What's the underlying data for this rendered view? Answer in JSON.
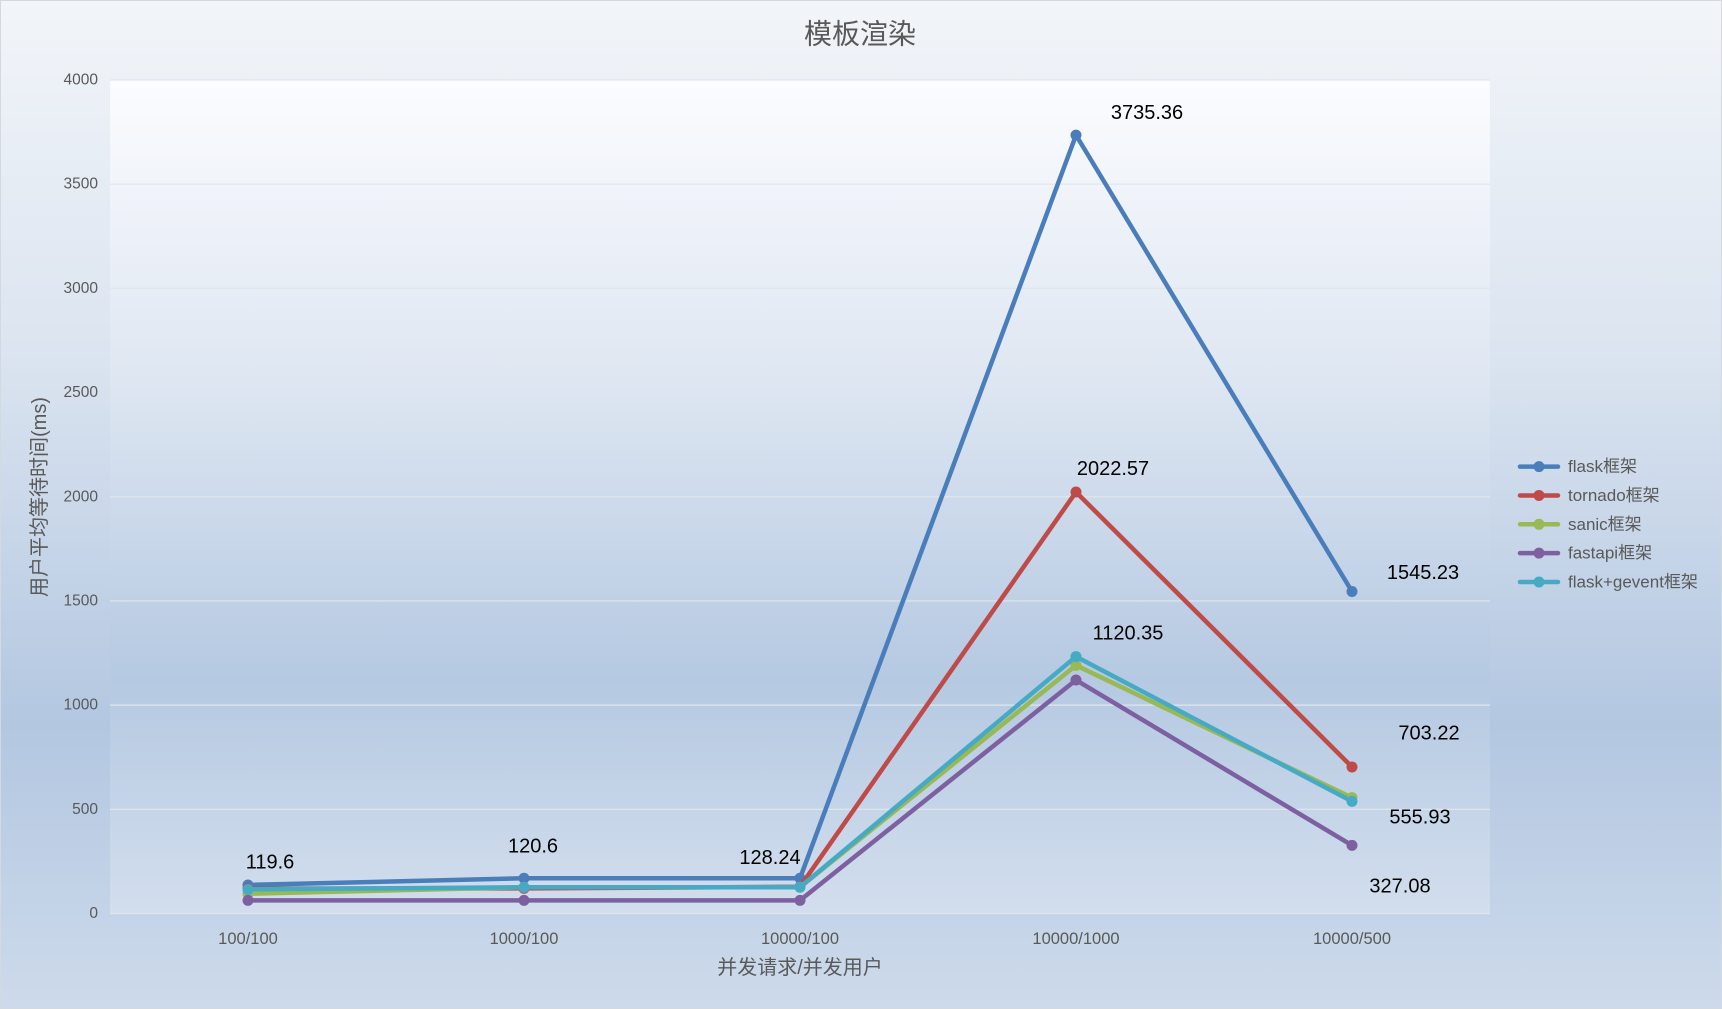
{
  "chart_data": {
    "type": "line",
    "title": "模板渲染",
    "xlabel": "并发请求/并发用户",
    "ylabel": "用户平均等待时间(ms)",
    "categories": [
      "100/100",
      "1000/100",
      "10000/100",
      "10000/1000",
      "10000/500"
    ],
    "ylim": [
      0,
      4000
    ],
    "yticks": [
      0,
      500,
      1000,
      1500,
      2000,
      2500,
      3000,
      3500,
      4000
    ],
    "grid": true,
    "markers": true,
    "legend_position": "right",
    "series": [
      {
        "name": "flask框架",
        "color": "#4A7EBB",
        "values": [
          137,
          169,
          169,
          3735.36,
          1545.23
        ],
        "labels": [
          null,
          null,
          null,
          "3735.36",
          "1545.23"
        ]
      },
      {
        "name": "tornado框架",
        "color": "#BE4B48",
        "values": [
          119.6,
          120.6,
          128.24,
          2022.57,
          703.22
        ],
        "labels": [
          "119.6",
          "120.6",
          "128.24",
          "2022.57",
          "703.22"
        ]
      },
      {
        "name": "sanic框架",
        "color": "#98B954",
        "values": [
          95,
          126,
          126,
          1191,
          555.93
        ],
        "labels": [
          null,
          null,
          null,
          null,
          "555.93"
        ]
      },
      {
        "name": "fastapi框架",
        "color": "#7D60A0",
        "values": [
          63,
          63,
          63,
          1120.35,
          327.08
        ],
        "labels": [
          null,
          null,
          null,
          "1120.35",
          "327.08"
        ]
      },
      {
        "name": "flask+gevent框架",
        "color": "#46AAC5",
        "values": [
          116,
          126,
          126,
          1233,
          538
        ],
        "labels": [
          null,
          null,
          null,
          null,
          null
        ]
      }
    ]
  }
}
